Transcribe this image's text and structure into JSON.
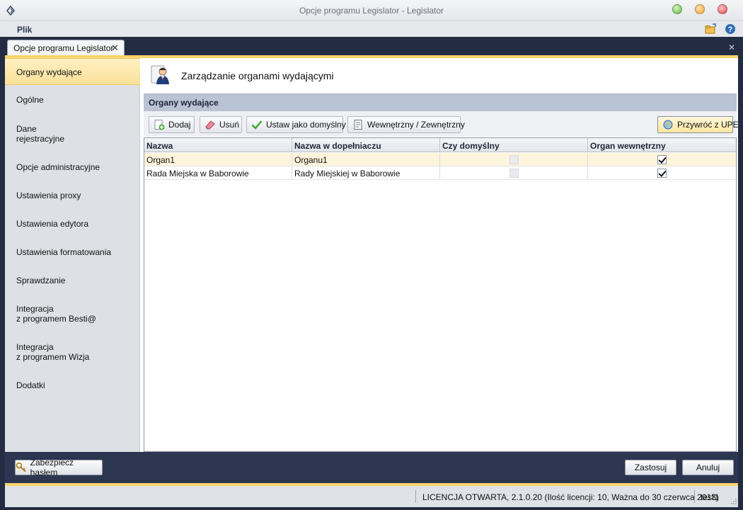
{
  "window": {
    "title": "Opcje programu Legislator - Legislator"
  },
  "menu": {
    "file": "Plik"
  },
  "tabs": [
    {
      "label": "Opcje programu Legislator"
    }
  ],
  "sidebar": {
    "items": [
      {
        "label": "Organy wydające",
        "active": true
      },
      {
        "label": "Ogólne"
      },
      {
        "label": "Dane\nrejestracyjne"
      },
      {
        "label": "Opcje administracyjne"
      },
      {
        "label": "Ustawienia proxy"
      },
      {
        "label": "Ustawienia edytora"
      },
      {
        "label": "Ustawienia formatowania"
      },
      {
        "label": "Sprawdzanie"
      },
      {
        "label": "Integracja\nz programem Besti@"
      },
      {
        "label": "Integracja\nz programem Wizja"
      },
      {
        "label": "Dodatki"
      }
    ]
  },
  "content": {
    "title": "Zarządzanie organami wydającymi",
    "section": "Organy wydające"
  },
  "toolbar": {
    "add": "Dodaj",
    "remove": "Usuń",
    "set_default": "Ustaw jako domyślny",
    "internal_external": "Wewnętrzny / Zewnętrzny",
    "restore": "Przywróć z UPE"
  },
  "grid": {
    "columns": [
      "Nazwa",
      "Nazwa w dopełniaczu",
      "Czy domyślny",
      "Organ wewnętrzny"
    ],
    "rows": [
      {
        "name": "Organ1",
        "genitive": "Organu1",
        "is_default": false,
        "internal": true,
        "selected": true
      },
      {
        "name": "Rada Miejska w Baborowie",
        "genitive": "Rady Miejskiej w Baborowie",
        "is_default": false,
        "internal": true,
        "selected": false
      }
    ]
  },
  "footer": {
    "protect": "Zabezpiecz hasłem",
    "apply": "Zastosuj",
    "cancel": "Anuluj"
  },
  "status": {
    "license": "LICENCJA OTWARTA, 2.1.0.20 (Ilość licencji: 10, Ważna do 30 czerwca 2013)",
    "user": "test1"
  },
  "colors": {
    "accent": "#f7d36c",
    "frame": "#232c42",
    "selected_row": "#fdf4dc"
  }
}
